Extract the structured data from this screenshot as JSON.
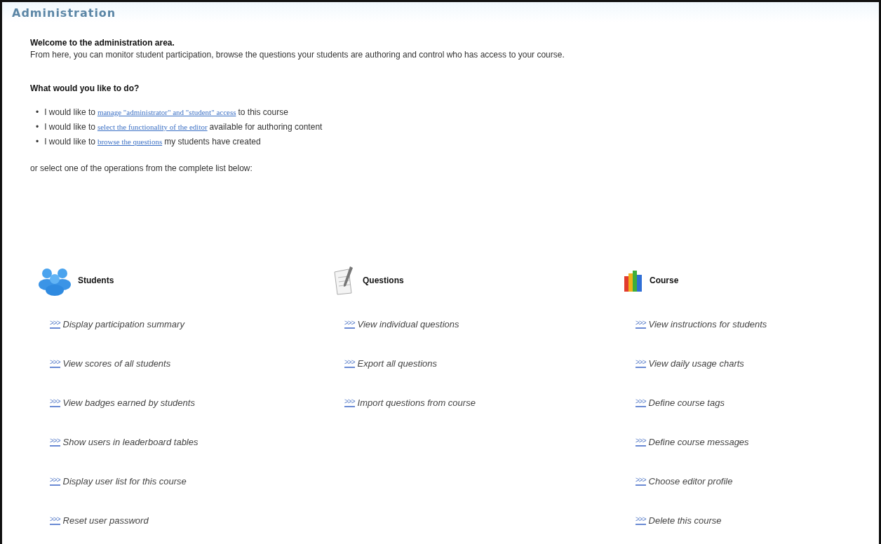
{
  "title": "Administration",
  "intro": {
    "heading": "Welcome to the administration area.",
    "text": "From here, you can monitor student participation, browse the questions your students are authoring and control who has access to your course."
  },
  "question": "What would you like to do?",
  "shortcuts": [
    {
      "bullet": "•",
      "before": "I would like to",
      "link": "manage \"administrator\" and \"student\" access",
      "after": "to this course"
    },
    {
      "bullet": "•",
      "before": "I would like to",
      "link": "select the functionality of the editor",
      "after": "available for authoring content"
    },
    {
      "bullet": "•",
      "before": "I would like to",
      "link": "browse the questions",
      "after": "my students have created"
    }
  ],
  "or_text": "or select one of the operations from the complete list below:",
  "sections": [
    {
      "kind": "students",
      "title": "Students",
      "items": [
        {
          "arrow": ">>>",
          "label": "Display participation summary"
        },
        {
          "arrow": ">>>",
          "label": "View scores of all students"
        },
        {
          "arrow": ">>>",
          "label": "View badges earned by students"
        },
        {
          "arrow": ">>>",
          "label": "Show users in leaderboard tables"
        },
        {
          "arrow": ">>>",
          "label": "Display user list for this course"
        },
        {
          "arrow": ">>>",
          "label": "Reset user password"
        }
      ]
    },
    {
      "kind": "questions",
      "title": "Questions",
      "items": [
        {
          "arrow": ">>>",
          "label": "View individual questions"
        },
        {
          "arrow": ">>>",
          "label": "Export all questions"
        },
        {
          "arrow": ">>>",
          "label": "Import questions from course"
        }
      ]
    },
    {
      "kind": "course",
      "title": "Course",
      "items": [
        {
          "arrow": ">>>",
          "label": "View instructions for students"
        },
        {
          "arrow": ">>>",
          "label": "View daily usage charts"
        },
        {
          "arrow": ">>>",
          "label": "Define course tags"
        },
        {
          "arrow": ">>>",
          "label": "Define course messages"
        },
        {
          "arrow": ">>>",
          "label": "Choose editor profile"
        },
        {
          "arrow": ">>>",
          "label": "Delete this course"
        }
      ]
    }
  ]
}
